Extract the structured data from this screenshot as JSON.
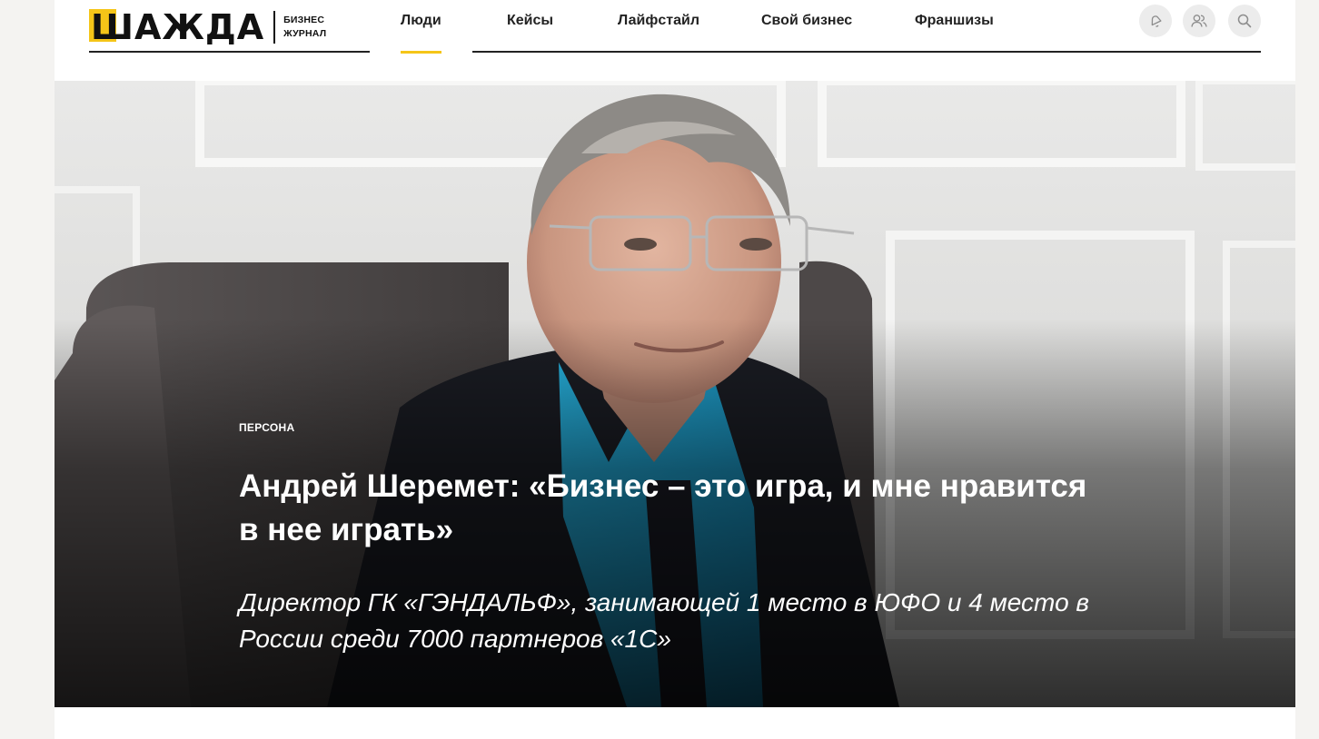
{
  "logo": {
    "wordmark": "ШАЖДА",
    "sub_line1": "БИЗНЕС",
    "sub_line2": "ЖУРНАЛ"
  },
  "nav": {
    "items": [
      {
        "label": "Люди",
        "active": true
      },
      {
        "label": "Кейсы",
        "active": false
      },
      {
        "label": "Лайфстайл",
        "active": false
      },
      {
        "label": "Свой бизнес",
        "active": false
      },
      {
        "label": "Франшизы",
        "active": false
      }
    ]
  },
  "header_icons": [
    "bell-icon",
    "users-icon",
    "search-icon"
  ],
  "colors": {
    "accent": "#f5c518",
    "text": "#222222",
    "icon_bg": "#ececec",
    "shirt": "#1a9bc9",
    "suit": "#1b1d24"
  },
  "hero": {
    "category": "ПЕРСОНА",
    "title_line1": "Андрей Шеремет: «Бизнес – это игра, и мне нравится",
    "title_line2": "в нее играть»",
    "subtitle_line1": "Директор ГК «ГЭНДАЛЬФ», занимающей 1 место в ЮФО и 4 место в",
    "subtitle_line2": "России среди 7000 партнеров «1С»"
  }
}
